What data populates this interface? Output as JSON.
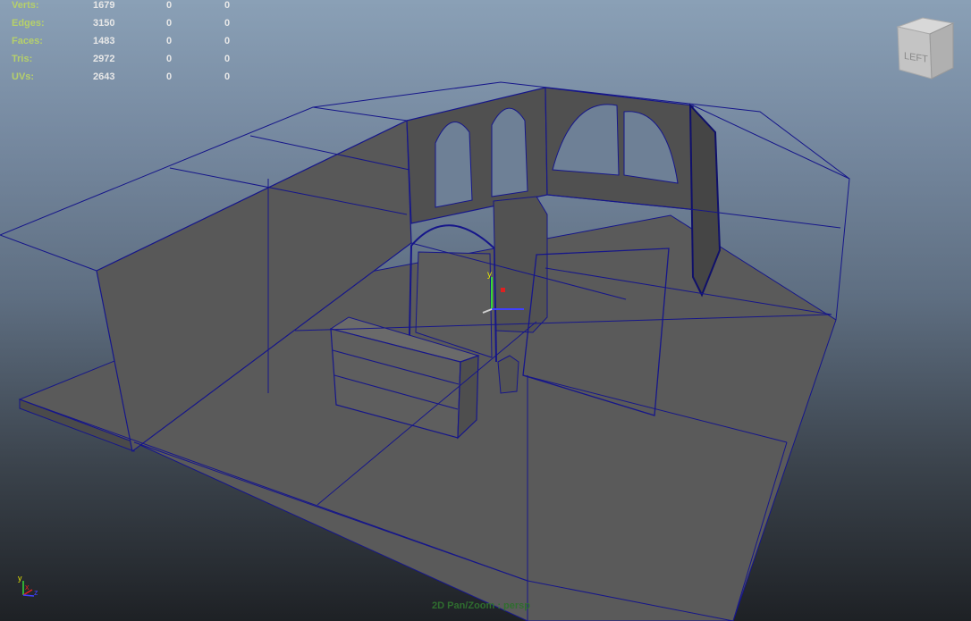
{
  "stats": {
    "rows": [
      {
        "label": "Verts:",
        "total": "1679",
        "selected": "0",
        "component": "0"
      },
      {
        "label": "Edges:",
        "total": "3150",
        "selected": "0",
        "component": "0"
      },
      {
        "label": "Faces:",
        "total": "1483",
        "selected": "0",
        "component": "0"
      },
      {
        "label": "Tris:",
        "total": "2972",
        "selected": "0",
        "component": "0"
      },
      {
        "label": "UVs:",
        "total": "2643",
        "selected": "0",
        "component": "0"
      }
    ]
  },
  "viewcube": {
    "face_label": "LEFT"
  },
  "camera_label": "2D Pan/Zoom : persp",
  "axis_gizmo": {
    "x": "x",
    "y": "y",
    "z": "z"
  },
  "manipulator": {
    "y": "y"
  },
  "colors": {
    "wireframe": "#1a1a9a",
    "floor": "#5a5a5a",
    "wall": "#555555",
    "hud_label": "#b6d06a",
    "hud_value": "#e8e8e8",
    "camera_label": "#2f6e2f"
  }
}
